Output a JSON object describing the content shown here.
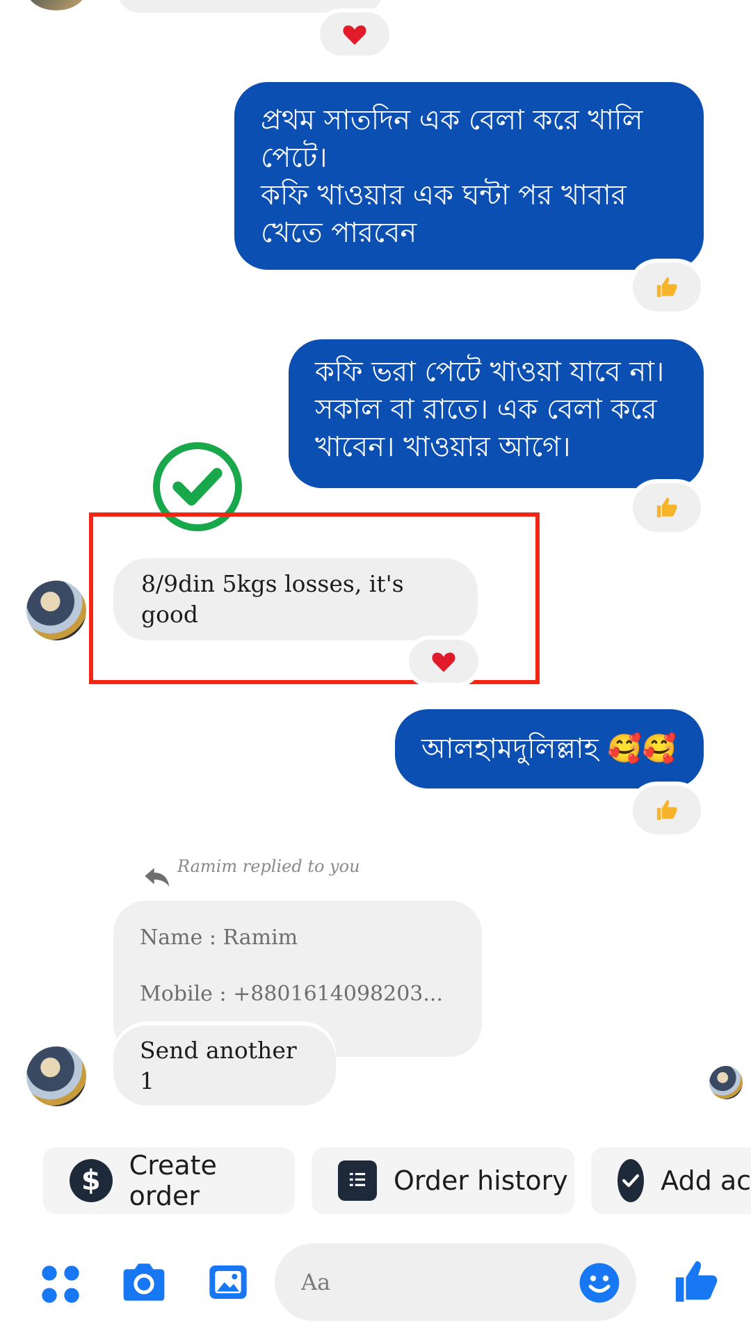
{
  "thread": {
    "msg_out_1": [
      "প্রথম সাতদিন এক বেলা করে খালি",
      "পেটে।",
      "কফি খাওয়ার এক ঘন্টা পর খাবার",
      "খেতে পারবেন"
    ],
    "msg_out_2": [
      "কফি ভরা পেটে খাওয়া যাবে না।",
      "সকাল বা রাতে। এক বেলা করে",
      "খাবেন। খাওয়ার আগে।"
    ],
    "msg_in_1": "8/9din 5kgs losses, it's good",
    "msg_out_3": "আলহামদুলিল্লাহ 🥰🥰",
    "reply_label": "Ramim replied to you",
    "quoted_lines": [
      "Name : Ramim",
      "Mobile : +8801614098203..."
    ],
    "msg_in_2": "Send another 1"
  },
  "quick_actions": [
    {
      "label": "Create order",
      "icon": "dollar-icon"
    },
    {
      "label": "Order history",
      "icon": "document-icon"
    },
    {
      "label": "Add ac",
      "icon": "check-icon"
    }
  ],
  "composer": {
    "placeholder": "Aa"
  },
  "colors": {
    "outgoing_bubble": "#0a4fb1",
    "incoming_bubble": "#efefef",
    "accent_blue": "#1877f2",
    "highlight_red": "#f32515",
    "check_green": "#19a74b"
  }
}
